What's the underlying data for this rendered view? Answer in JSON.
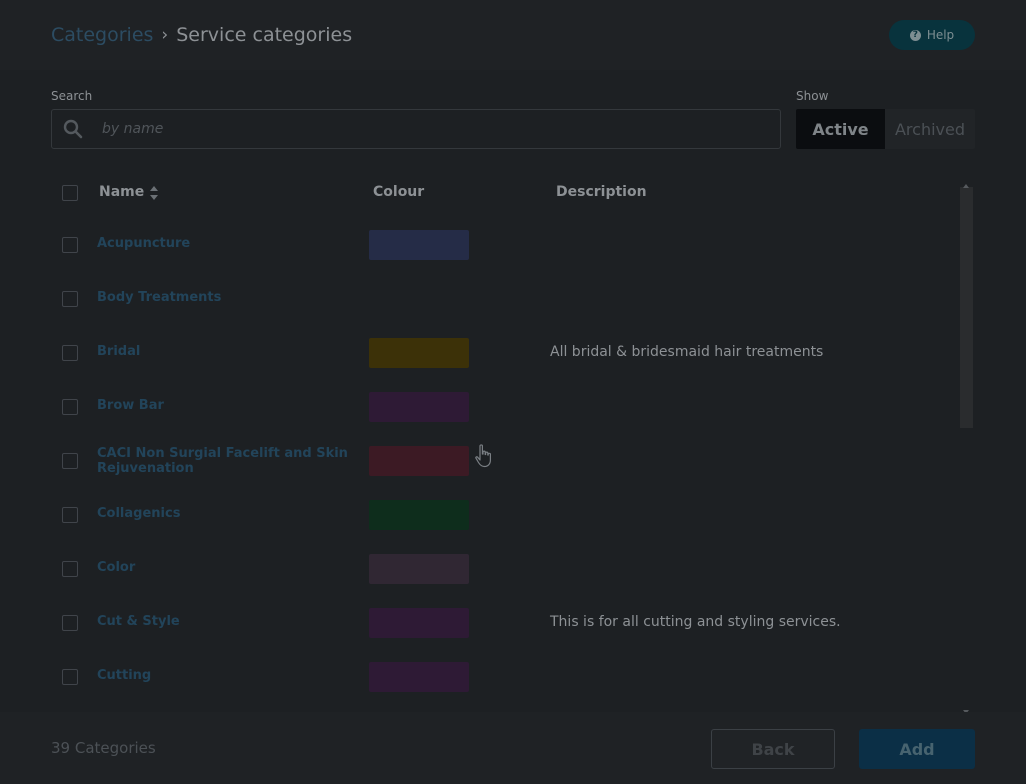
{
  "breadcrumb": {
    "parent": "Categories",
    "separator": "›",
    "current": "Service categories"
  },
  "help": {
    "label": "Help"
  },
  "search": {
    "label": "Search",
    "placeholder": "by name",
    "value": ""
  },
  "show": {
    "label": "Show",
    "active": "Active",
    "archived": "Archived",
    "selected": "Active"
  },
  "table": {
    "columns": {
      "name": "Name",
      "colour": "Colour",
      "description": "Description"
    },
    "rows": [
      {
        "name": "Acupuncture",
        "colour": "#252c47",
        "description": ""
      },
      {
        "name": "Body Treatments",
        "colour": "",
        "description": ""
      },
      {
        "name": "Bridal",
        "colour": "#3c3108",
        "description": "All bridal & bridesmaid hair treatments"
      },
      {
        "name": "Brow Bar",
        "colour": "#2e1a35",
        "description": ""
      },
      {
        "name": "CACI Non Surgial Facelift and Skin Rejuvenation",
        "colour": "#3c1a24",
        "description": ""
      },
      {
        "name": "Collagenics",
        "colour": "#0e2d1c",
        "description": ""
      },
      {
        "name": "Color",
        "colour": "#302733",
        "description": ""
      },
      {
        "name": "Cut & Style",
        "colour": "#2e1a35",
        "description": "This is for all cutting and styling services."
      },
      {
        "name": "Cutting",
        "colour": "#2e1a35",
        "description": ""
      }
    ]
  },
  "footer": {
    "count": "39 Categories",
    "back": "Back",
    "add": "Add"
  },
  "icons": {
    "search": "search-icon",
    "help": "question-circle-icon",
    "sort": "sort-icon",
    "cursor": "hand-pointer-icon"
  },
  "colors": {
    "link": "#22445a",
    "active_toggle": "#0b0d10",
    "add_button": "#0b2f46",
    "overlay": "#1d2023"
  }
}
